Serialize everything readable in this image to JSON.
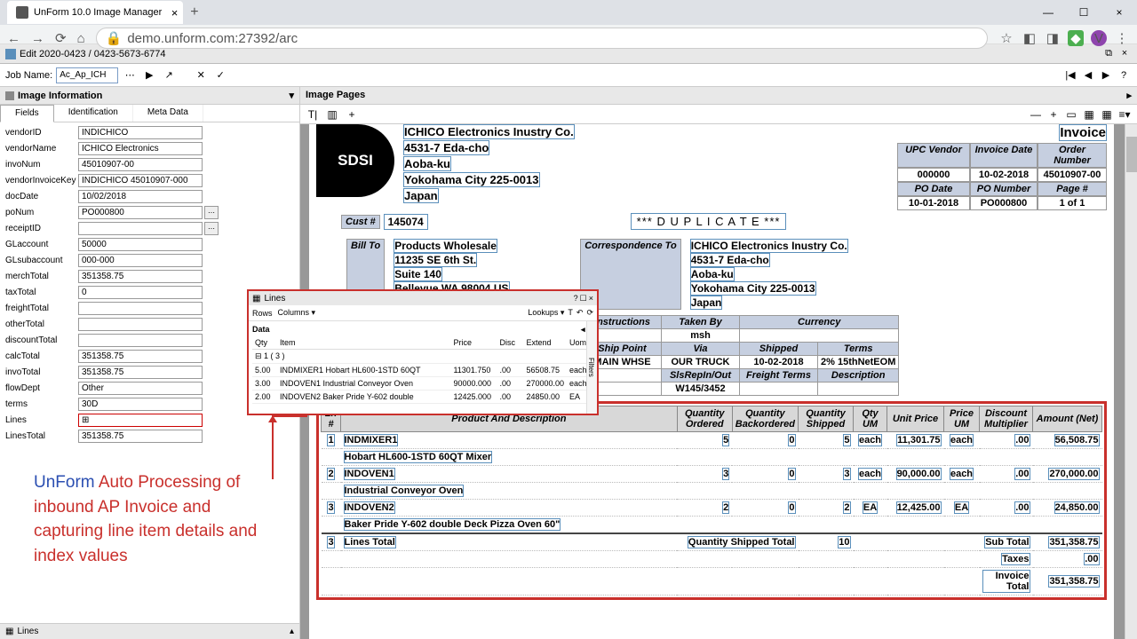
{
  "browser": {
    "tab_title": "UnForm 10.0 Image Manager",
    "url": "demo.unform.com:27392/arc",
    "avatar": "V"
  },
  "app_bar": {
    "title": "Edit 2020-0423 / 0423-5673-6774"
  },
  "toolbar": {
    "job_label": "Job Name:",
    "job_value": "Ac_Ap_ICH"
  },
  "left": {
    "header": "Image Information",
    "tabs": {
      "fields": "Fields",
      "ident": "Identification",
      "meta": "Meta Data"
    },
    "fields": {
      "vendorID": "INDICHICO",
      "vendorName": "ICHICO Electronics",
      "invoNum": "45010907-00",
      "vendorInvoiceKey": "INDICHICO 45010907-000",
      "docDate": "10/02/2018",
      "poNum": "PO000800",
      "receiptID": "",
      "GLaccount": "50000",
      "GLsubaccount": "000-000",
      "merchTotal": "351358.75",
      "taxTotal": "0",
      "freightTotal": "",
      "otherTotal": "",
      "discountTotal": "",
      "calcTotal": "351358.75",
      "invoTotal": "351358.75",
      "flowDept": "Other",
      "terms": "30D",
      "Lines": "⊞",
      "LinesTotal": "351358.75"
    },
    "labels": {
      "vendorID": "vendorID",
      "vendorName": "vendorName",
      "invoNum": "invoNum",
      "vendorInvoiceKey": "vendorInvoiceKey",
      "docDate": "docDate",
      "poNum": "poNum",
      "receiptID": "receiptID",
      "GLaccount": "GLaccount",
      "GLsubaccount": "GLsubaccount",
      "merchTotal": "merchTotal",
      "taxTotal": "taxTotal",
      "freightTotal": "freightTotal",
      "otherTotal": "otherTotal",
      "discountTotal": "discountTotal",
      "calcTotal": "calcTotal",
      "invoTotal": "invoTotal",
      "flowDept": "flowDept",
      "terms": "terms",
      "Lines": "Lines",
      "LinesTotal": "LinesTotal"
    }
  },
  "annotation": {
    "blue": "UnForm ",
    "rest": "Auto Processing of inbound AP Invoice and capturing line item details and index values"
  },
  "lines_popup": {
    "title": "Lines",
    "rows": "Rows",
    "cols": "Columns ▾",
    "lookups": "Lookups ▾",
    "data": "Data",
    "headers": {
      "qty": "Qty",
      "item": "Item",
      "price": "Price",
      "disc": "Disc",
      "extend": "Extend",
      "uom": "Uom"
    },
    "group": "⊟ 1 ( 3 )",
    "rows_data": [
      {
        "qty": "5.00",
        "item": "INDMIXER1 Hobart HL600-1STD 60QT",
        "price": "11301.750",
        "disc": ".00",
        "extend": "56508.75",
        "uom": "each"
      },
      {
        "qty": "3.00",
        "item": "INDOVEN1 Industrial Conveyor Oven",
        "price": "90000.000",
        "disc": ".00",
        "extend": "270000.00",
        "uom": "each"
      },
      {
        "qty": "2.00",
        "item": "INDOVEN2 Baker Pride Y-602 double",
        "price": "12425.000",
        "disc": ".00",
        "extend": "24850.00",
        "uom": "EA"
      }
    ],
    "side": "Filters"
  },
  "right": {
    "header": "Image Pages"
  },
  "doc": {
    "logo": "SDSI",
    "vendor": {
      "name": "ICHICO Electronics Inustry Co.",
      "addr1": "4531-7 Eda-cho",
      "addr2": "Aoba-ku",
      "city": "Yokohama City 225-0013",
      "country": "Japan"
    },
    "invoice_title": "Invoice",
    "meta": {
      "h1": "UPC Vendor",
      "h2": "Invoice Date",
      "h3": "Order Number",
      "v1": "000000",
      "v2": "10-02-2018",
      "v3": "45010907-00",
      "h4": "PO Date",
      "h5": "PO Number",
      "h6": "Page #",
      "v4": "10-01-2018",
      "v5": "PO000800",
      "v6": "1 of 1"
    },
    "cust_lbl": "Cust #",
    "cust_val": "145074",
    "dup": "*** D U P L I C A T E ***",
    "billto_lbl": "Bill To",
    "billto": {
      "l1": "Products Wholesale",
      "l2": "11235 SE 6th St.",
      "l3": "Suite 140",
      "l4": "Bellevue WA  98004 US"
    },
    "corr_lbl": "Correspondence To",
    "ship": {
      "instr": "Instructions",
      "taken": "Taken By",
      "curr": "Currency",
      "taken_v": "msh",
      "shippoint": "Ship Point",
      "via": "Via",
      "shipped": "Shipped",
      "terms": "Terms",
      "shippoint_v": "MAIN WHSE",
      "via_v": "OUR TRUCK",
      "shipped_v": "10-02-2018",
      "terms_v": "2% 15thNetEOM",
      "sls": "SlsRepIn/Out",
      "freight": "Freight Terms",
      "descr": "Description",
      "sls_v": "W145/3452"
    },
    "lt_headers": {
      "ln": "Ln #",
      "prod": "Product And Description",
      "qord": "Quantity Ordered",
      "qback": "Quantity Backordered",
      "qship": "Quantity Shipped",
      "qum": "Qty UM",
      "uprice": "Unit Price",
      "pum": "Price UM",
      "dmult": "Discount Multiplier",
      "amt": "Amount (Net)"
    },
    "lines": [
      {
        "n": "1",
        "prod": "INDMIXER1",
        "desc": "Hobart HL600-1STD 60QT Mixer",
        "qord": "5",
        "qback": "0",
        "qship": "5",
        "qum": "each",
        "uprice": "11,301.75",
        "pum": "each",
        "dmult": ".00",
        "amt": "56,508.75"
      },
      {
        "n": "2",
        "prod": "INDOVEN1",
        "desc": "Industrial Conveyor Oven",
        "qord": "3",
        "qback": "0",
        "qship": "3",
        "qum": "each",
        "uprice": "90,000.00",
        "pum": "each",
        "dmult": ".00",
        "amt": "270,000.00"
      },
      {
        "n": "3",
        "prod": "INDOVEN2",
        "desc": "Baker Pride Y-602 double Deck Pizza Oven 60\"",
        "qord": "2",
        "qback": "0",
        "qship": "2",
        "qum": "EA",
        "uprice": "12,425.00",
        "pum": "EA",
        "dmult": ".00",
        "amt": "24,850.00"
      }
    ],
    "totals": {
      "count": "3",
      "lineslbl": "Lines Total",
      "qshiplbl": "Quantity Shipped Total",
      "qship": "10",
      "sub": "Sub Total",
      "sub_v": "351,358.75",
      "tax": "Taxes",
      "tax_v": ".00",
      "inv": "Invoice Total",
      "inv_v": "351,358.75"
    }
  },
  "bottom": {
    "label": "Lines"
  }
}
